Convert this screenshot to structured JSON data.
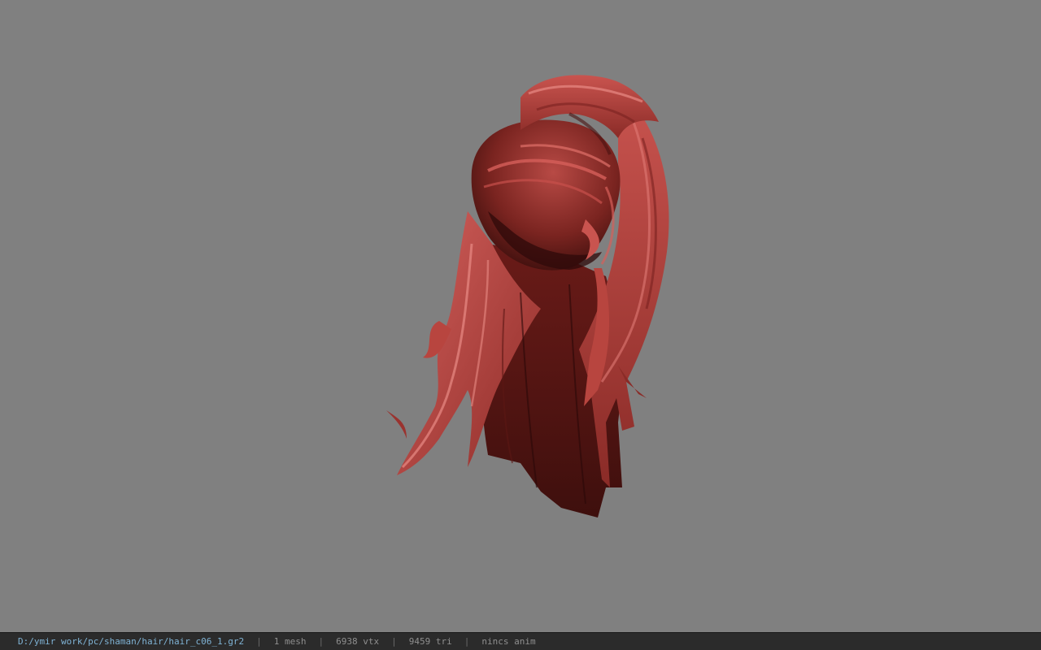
{
  "viewport": {
    "background": "#808080",
    "model_name": "hair model (red ponytail)"
  },
  "statusbar": {
    "file_path": "D:/ymir work/pc/shaman/hair/hair_c06_1.gr2",
    "separator": "|",
    "mesh_count": "1 mesh",
    "vertex_count": "6938 vtx",
    "triangle_count": "9459 tri",
    "anim_status": "nincs anim"
  },
  "colors": {
    "hair_highlight": "#d4615d",
    "hair_mid": "#a83a36",
    "hair_dark": "#4a1210",
    "statusbar_bg": "#2b2b2b",
    "path_text": "#7fb3d5",
    "info_text": "#8f8f8f"
  }
}
